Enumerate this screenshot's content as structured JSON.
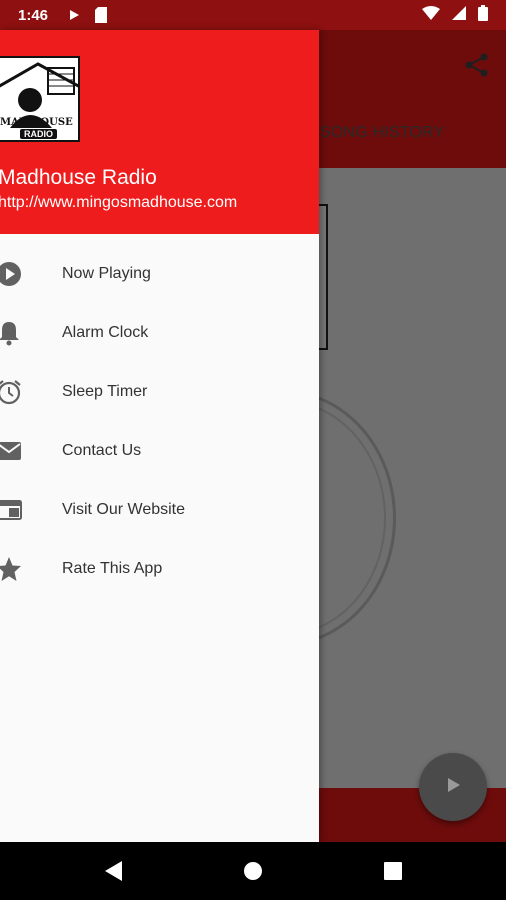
{
  "status_bar": {
    "time": "1:46",
    "icons": [
      "play-icon",
      "sd-card-icon",
      "wifi-icon",
      "signal-icon",
      "battery-icon"
    ]
  },
  "app": {
    "tab_label": "SONG HISTORY",
    "share_icon": "share-icon",
    "fab_icon": "play-icon"
  },
  "drawer": {
    "logo_text": "MAD HOUSE",
    "logo_sub": "RADIO",
    "title": "Madhouse Radio",
    "url": "http://www.mingosmadhouse.com",
    "items": [
      {
        "label": "Now Playing",
        "icon": "play-circle-icon"
      },
      {
        "label": "Alarm Clock",
        "icon": "bell-icon"
      },
      {
        "label": "Sleep Timer",
        "icon": "alarm-clock-icon"
      },
      {
        "label": "Contact Us",
        "icon": "mail-icon"
      },
      {
        "label": "Visit Our Website",
        "icon": "web-icon"
      },
      {
        "label": "Rate This App",
        "icon": "star-icon"
      }
    ]
  },
  "nav_bar": {
    "buttons": [
      "back-icon",
      "home-icon",
      "recents-icon"
    ]
  },
  "colors": {
    "header_red": "#ee1c1c",
    "status_bar": "#8e1010",
    "scrim_toolbar": "#6e0c0c",
    "drawer_bg": "#fafafa",
    "menu_text": "#333333"
  }
}
